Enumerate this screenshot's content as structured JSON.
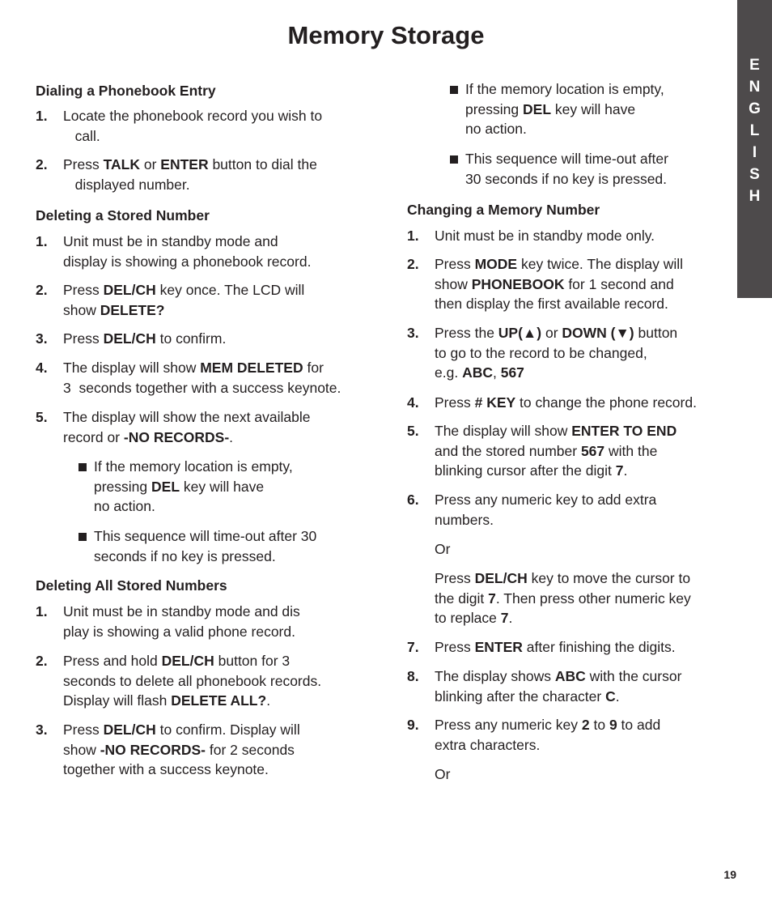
{
  "page": {
    "title": "Memory Storage",
    "page_number": "19",
    "language_tab": [
      "E",
      "N",
      "G",
      "L",
      "I",
      "S",
      "H"
    ]
  },
  "left_column": [
    {
      "type": "heading",
      "text": "Dialing a Phonebook Entry"
    },
    {
      "type": "step",
      "number": "1.",
      "lines": [
        [
          {
            "t": "Locate the phonebook record you wish to"
          }
        ],
        [
          {
            "t": "   call."
          }
        ]
      ]
    },
    {
      "type": "step",
      "number": "2.",
      "lines": [
        [
          {
            "t": "Press "
          },
          {
            "t": "TALK",
            "b": true
          },
          {
            "t": " or "
          },
          {
            "t": "ENTER",
            "b": true
          },
          {
            "t": " button to dial the"
          }
        ],
        [
          {
            "t": "   displayed number."
          }
        ]
      ]
    },
    {
      "type": "heading",
      "text": "Deleting a Stored Number"
    },
    {
      "type": "step",
      "number": "1.",
      "lines": [
        [
          {
            "t": "Unit must be in standby mode and"
          }
        ],
        [
          {
            "t": "display is showing a phonebook record."
          }
        ]
      ]
    },
    {
      "type": "step",
      "number": "2.",
      "lines": [
        [
          {
            "t": "Press "
          },
          {
            "t": "DEL/CH",
            "b": true
          },
          {
            "t": " key once. The LCD will"
          }
        ],
        [
          {
            "t": "show "
          },
          {
            "t": "DELETE?",
            "b": true
          }
        ]
      ]
    },
    {
      "type": "step",
      "number": "3.",
      "lines": [
        [
          {
            "t": "Press "
          },
          {
            "t": "DEL/CH",
            "b": true
          },
          {
            "t": " to confirm."
          }
        ]
      ]
    },
    {
      "type": "step",
      "number": "4.",
      "lines": [
        [
          {
            "t": "The display will show "
          },
          {
            "t": "MEM DELETED",
            "b": true
          },
          {
            "t": " for"
          }
        ],
        [
          {
            "t": "3  seconds together with a success keynote."
          }
        ]
      ]
    },
    {
      "type": "step",
      "number": "5.",
      "lines": [
        [
          {
            "t": "The display will show the next available"
          }
        ],
        [
          {
            "t": "record or "
          },
          {
            "t": "-NO RECORDS-",
            "b": true
          },
          {
            "t": "."
          }
        ]
      ]
    },
    {
      "type": "bullet",
      "lines": [
        [
          {
            "t": "If the memory location is empty,"
          }
        ],
        [
          {
            "t": "pressing "
          },
          {
            "t": "DEL",
            "b": true
          },
          {
            "t": " key will have"
          }
        ],
        [
          {
            "t": "no action."
          }
        ]
      ]
    },
    {
      "type": "bullet",
      "lines": [
        [
          {
            "t": "This sequence will time-out after 30"
          }
        ],
        [
          {
            "t": "seconds if no key is pressed."
          }
        ]
      ]
    },
    {
      "type": "heading",
      "text": "Deleting All Stored Numbers"
    },
    {
      "type": "step",
      "number": "1.",
      "lines": [
        [
          {
            "t": "Unit must be in standby mode and dis"
          }
        ],
        [
          {
            "t": "play is showing a valid phone record."
          }
        ]
      ]
    },
    {
      "type": "step",
      "number": "2.",
      "lines": [
        [
          {
            "t": "Press and hold "
          },
          {
            "t": "DEL/CH",
            "b": true
          },
          {
            "t": " button for 3"
          }
        ],
        [
          {
            "t": "seconds to delete all phonebook records."
          }
        ],
        [
          {
            "t": "Display will flash "
          },
          {
            "t": "DELETE ALL?",
            "b": true
          },
          {
            "t": "."
          }
        ]
      ]
    },
    {
      "type": "step",
      "number": "3.",
      "lines": [
        [
          {
            "t": "Press "
          },
          {
            "t": "DEL/CH",
            "b": true
          },
          {
            "t": " to confirm. Display will"
          }
        ],
        [
          {
            "t": "show "
          },
          {
            "t": "-NO RECORDS-",
            "b": true
          },
          {
            "t": " for 2 seconds"
          }
        ],
        [
          {
            "t": "together with a success keynote."
          }
        ]
      ]
    }
  ],
  "right_column": [
    {
      "type": "bullet",
      "lines": [
        [
          {
            "t": "If the memory location is empty,"
          }
        ],
        [
          {
            "t": "pressing "
          },
          {
            "t": "DEL",
            "b": true
          },
          {
            "t": " key will have"
          }
        ],
        [
          {
            "t": "no action."
          }
        ]
      ]
    },
    {
      "type": "bullet",
      "lines": [
        [
          {
            "t": "This sequence will time-out after"
          }
        ],
        [
          {
            "t": "30 seconds if no key is pressed."
          }
        ]
      ]
    },
    {
      "type": "heading",
      "text": "Changing a Memory Number"
    },
    {
      "type": "step",
      "number": "1.",
      "lines": [
        [
          {
            "t": "Unit must be in standby mode only."
          }
        ]
      ]
    },
    {
      "type": "step",
      "number": "2.",
      "lines": [
        [
          {
            "t": "Press "
          },
          {
            "t": "MODE",
            "b": true
          },
          {
            "t": " key twice. The display will"
          }
        ],
        [
          {
            "t": "show "
          },
          {
            "t": "PHONEBOOK",
            "b": true
          },
          {
            "t": " for 1 second and"
          }
        ],
        [
          {
            "t": "then display the first available record."
          }
        ]
      ]
    },
    {
      "type": "step",
      "number": "3.",
      "lines": [
        [
          {
            "t": "Press the "
          },
          {
            "t": "UP(▲)",
            "b": true
          },
          {
            "t": " or "
          },
          {
            "t": "DOWN (▼)",
            "b": true
          },
          {
            "t": " button"
          }
        ],
        [
          {
            "t": "to go to the record to be changed,"
          }
        ],
        [
          {
            "t": "e.g. "
          },
          {
            "t": "ABC",
            "b": true
          },
          {
            "t": ", "
          },
          {
            "t": "567",
            "b": true
          }
        ]
      ]
    },
    {
      "type": "step",
      "number": "4.",
      "lines": [
        [
          {
            "t": "Press "
          },
          {
            "t": "# KEY",
            "b": true
          },
          {
            "t": " to change the phone record."
          }
        ]
      ]
    },
    {
      "type": "step",
      "number": "5.",
      "lines": [
        [
          {
            "t": "The display will show "
          },
          {
            "t": "ENTER TO END",
            "b": true
          }
        ],
        [
          {
            "t": "and the stored number "
          },
          {
            "t": "567",
            "b": true
          },
          {
            "t": " with the"
          }
        ],
        [
          {
            "t": "blinking cursor after the digit "
          },
          {
            "t": "7",
            "b": true
          },
          {
            "t": "."
          }
        ]
      ]
    },
    {
      "type": "step",
      "number": "6.",
      "lines": [
        [
          {
            "t": "Press any numeric key to add extra"
          }
        ],
        [
          {
            "t": "numbers."
          }
        ]
      ]
    },
    {
      "type": "para",
      "lines": [
        [
          {
            "t": "Or"
          }
        ]
      ]
    },
    {
      "type": "para",
      "lines": [
        [
          {
            "t": "Press "
          },
          {
            "t": "DEL/CH",
            "b": true
          },
          {
            "t": " key to move the cursor to"
          }
        ],
        [
          {
            "t": "the digit "
          },
          {
            "t": "7",
            "b": true
          },
          {
            "t": ". Then press other numeric key"
          }
        ],
        [
          {
            "t": "to replace "
          },
          {
            "t": "7",
            "b": true
          },
          {
            "t": "."
          }
        ]
      ]
    },
    {
      "type": "step",
      "number": "7.",
      "lines": [
        [
          {
            "t": "Press "
          },
          {
            "t": "ENTER",
            "b": true
          },
          {
            "t": " after finishing the digits."
          }
        ]
      ]
    },
    {
      "type": "step",
      "number": "8.",
      "lines": [
        [
          {
            "t": "The display shows "
          },
          {
            "t": "ABC",
            "b": true
          },
          {
            "t": " with the cursor"
          }
        ],
        [
          {
            "t": "blinking after the character "
          },
          {
            "t": "C",
            "b": true
          },
          {
            "t": "."
          }
        ]
      ]
    },
    {
      "type": "step",
      "number": "9.",
      "lines": [
        [
          {
            "t": "Press any numeric key "
          },
          {
            "t": "2",
            "b": true
          },
          {
            "t": " to "
          },
          {
            "t": "9",
            "b": true
          },
          {
            "t": " to add"
          }
        ],
        [
          {
            "t": "extra characters."
          }
        ]
      ]
    },
    {
      "type": "para",
      "lines": [
        [
          {
            "t": "Or"
          }
        ]
      ]
    }
  ]
}
